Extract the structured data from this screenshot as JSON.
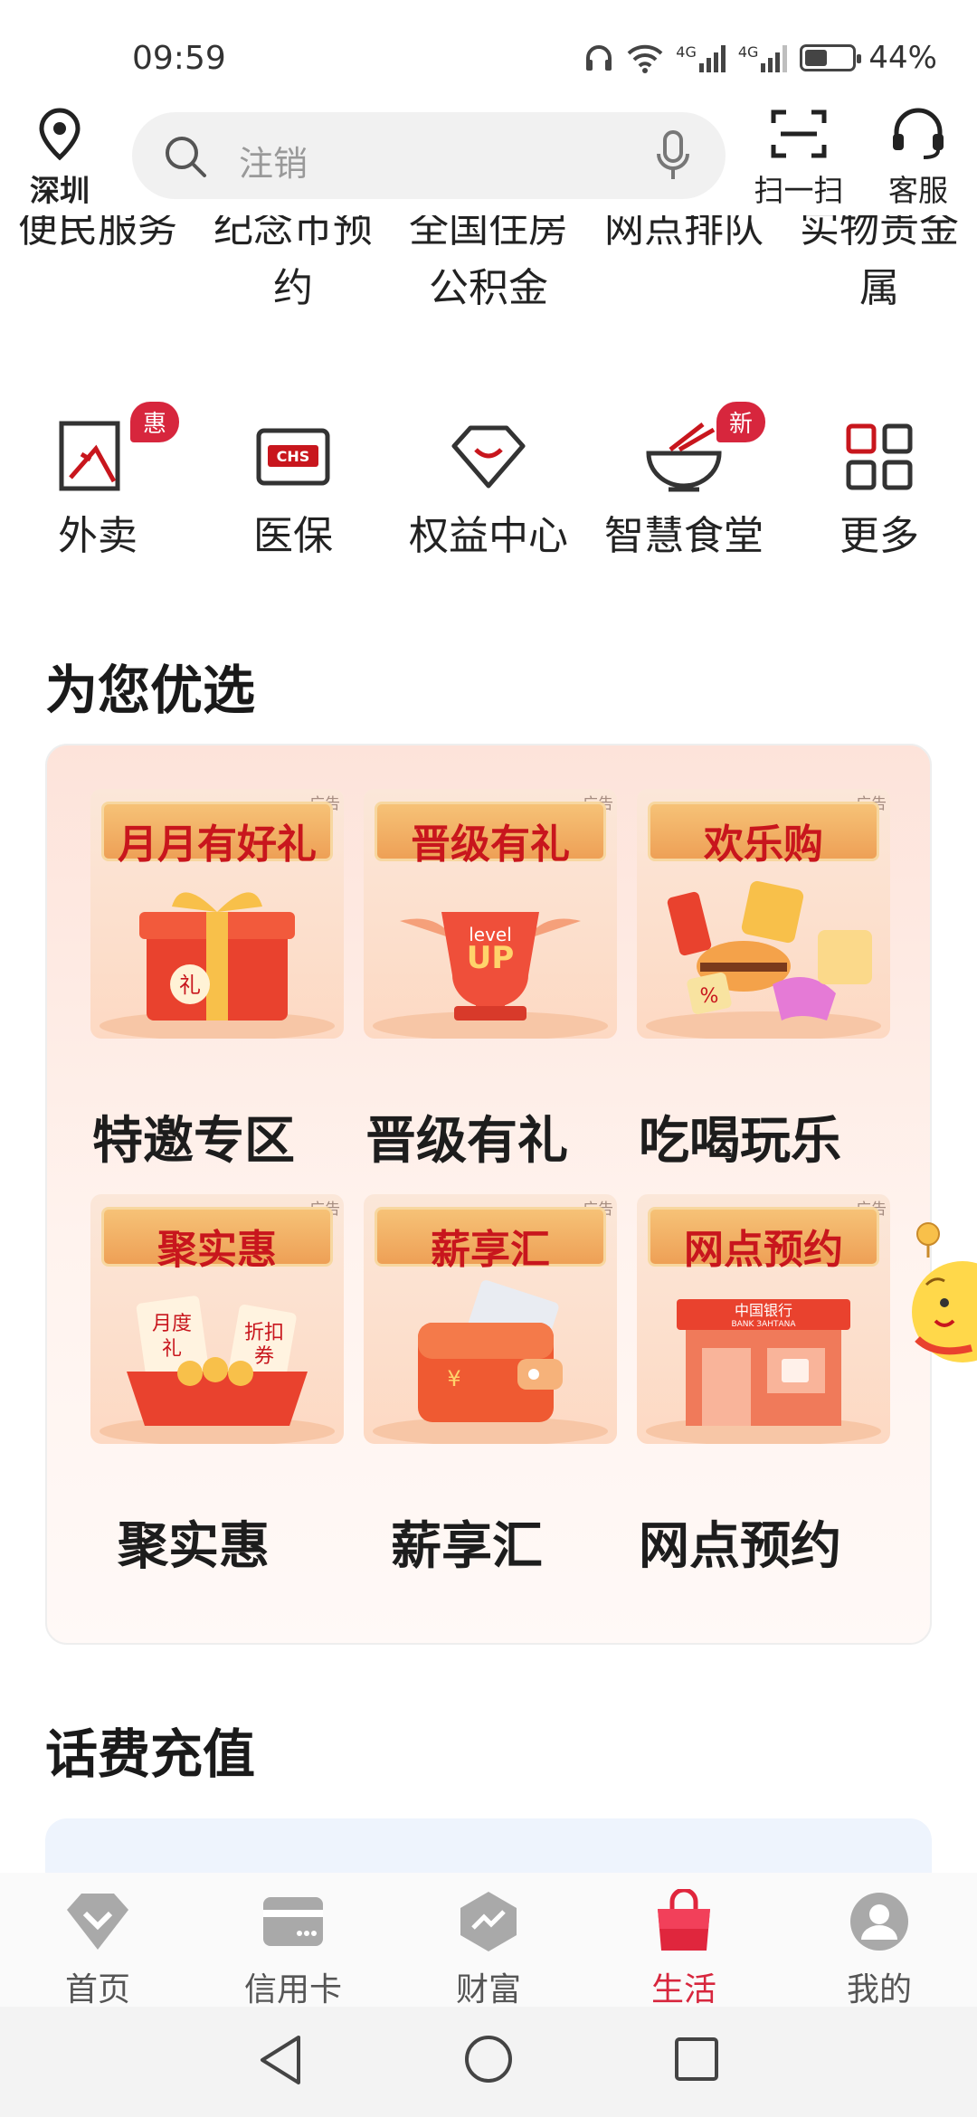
{
  "status_bar": {
    "time": "09:59",
    "network": "4G",
    "battery": "44%",
    "battery_level": 0.44
  },
  "header": {
    "location": "深圳",
    "search_placeholder": "注销",
    "scan_label": "扫一扫",
    "service_label": "客服"
  },
  "services_row1": [
    {
      "label_line1": "便民服务",
      "label_line2": "",
      "icon": "convenience-icon"
    },
    {
      "label_line1": "纪念币预",
      "label_line2": "约",
      "icon": "coin-icon"
    },
    {
      "label_line1": "全国住房",
      "label_line2": "公积金",
      "icon": "housing-fund-icon"
    },
    {
      "label_line1": "网点排队",
      "label_line2": "",
      "icon": "queue-icon"
    },
    {
      "label_line1": "实物贵金",
      "label_line2": "属",
      "icon": "gold-icon"
    }
  ],
  "services_row2": [
    {
      "label": "外卖",
      "icon": "takeout-icon",
      "badge": "惠"
    },
    {
      "label": "医保",
      "icon": "chs-icon",
      "badge": ""
    },
    {
      "label": "权益中心",
      "icon": "diamond-icon",
      "badge": ""
    },
    {
      "label": "智慧食堂",
      "icon": "bowl-icon",
      "badge": "新"
    },
    {
      "label": "更多",
      "icon": "grid-icon",
      "badge": ""
    }
  ],
  "featured": {
    "title": "为您优选",
    "ad_tag": "广告",
    "tiles": [
      {
        "banner": "月月有好礼",
        "caption": "特邀专区",
        "art_text": "礼"
      },
      {
        "banner": "晋级有礼",
        "caption": "晋级有礼",
        "art_text_1": "level",
        "art_text_2": "UP"
      },
      {
        "banner": "欢乐购",
        "caption": "吃喝玩乐",
        "art_text": "%"
      },
      {
        "banner": "聚实惠",
        "caption": "聚实惠",
        "art_text_1": "月度",
        "art_text_2": "礼",
        "art_text_3": "折扣",
        "art_text_4": "券"
      },
      {
        "banner": "薪享汇",
        "caption": "薪享汇",
        "art_text": "¥"
      },
      {
        "banner": "网点预约",
        "caption": "网点预约",
        "art_text_1": "中国银行",
        "art_text_2": "BANK ЗАНТАNА"
      }
    ]
  },
  "recharge": {
    "title": "话费充值"
  },
  "bottom_nav": [
    {
      "label": "首页",
      "icon": "home-diamond-icon"
    },
    {
      "label": "信用卡",
      "icon": "credit-card-icon"
    },
    {
      "label": "财富",
      "icon": "wealth-icon"
    },
    {
      "label": "生活",
      "icon": "life-bag-icon",
      "active": true
    },
    {
      "label": "我的",
      "icon": "profile-icon"
    }
  ],
  "colors": {
    "accent": "#d7263d",
    "promo_bg": "#fde3da",
    "banner_text": "#c8161d"
  }
}
